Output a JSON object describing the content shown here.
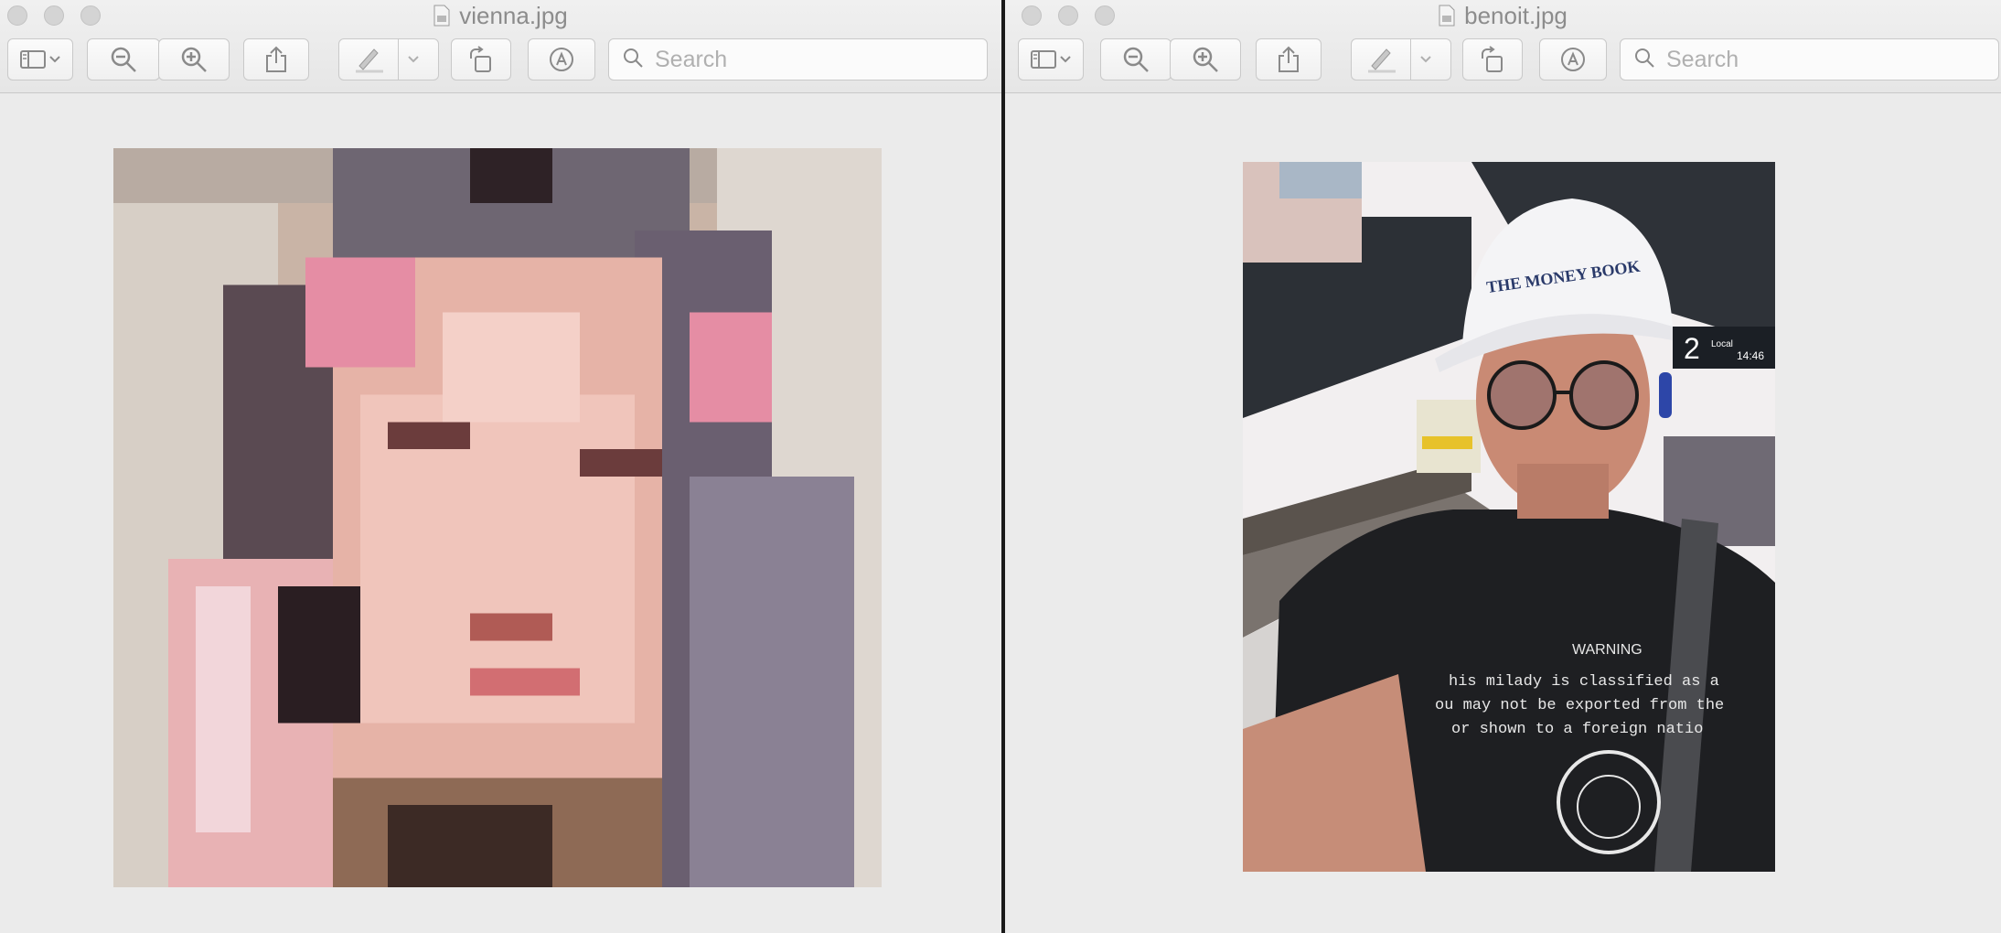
{
  "windows": [
    {
      "title": "vienna.jpg",
      "search": {
        "placeholder": "Search",
        "value": ""
      },
      "toolbar": {
        "sidebar_icon": "sidebar-icon",
        "zoom_out_icon": "zoom-out-icon",
        "zoom_in_icon": "zoom-in-icon",
        "share_icon": "share-icon",
        "markup_icon": "pen-icon",
        "rotate_icon": "rotate-icon",
        "annotate_icon": "markup-circle-icon",
        "search_icon": "search-icon"
      },
      "image": {
        "description": "pixelated portrait",
        "pixelated": true
      }
    },
    {
      "title": "benoit.jpg",
      "search": {
        "placeholder": "Search",
        "value": ""
      },
      "toolbar": {
        "sidebar_icon": "sidebar-icon",
        "zoom_out_icon": "zoom-out-icon",
        "zoom_in_icon": "zoom-in-icon",
        "share_icon": "share-icon",
        "markup_icon": "pen-icon",
        "rotate_icon": "rotate-icon",
        "annotate_icon": "markup-circle-icon",
        "search_icon": "search-icon"
      },
      "image": {
        "description": "selfie at a train platform",
        "cap_text": "THE MONEY BOOK",
        "platform_sign_number": "2",
        "platform_sign_label": "Local",
        "platform_sign_time": "14:46",
        "shirt_heading": "WARNING",
        "shirt_lines": [
          "his milady is classified as a",
          "ou may not be exported from the",
          "or shown to a foreign natio"
        ]
      }
    }
  ],
  "colors": {
    "titlebar": "#e8e8e8",
    "canvas": "#ebebeb",
    "divider": "#1a1a1a",
    "icon": "#8a8a8a"
  }
}
